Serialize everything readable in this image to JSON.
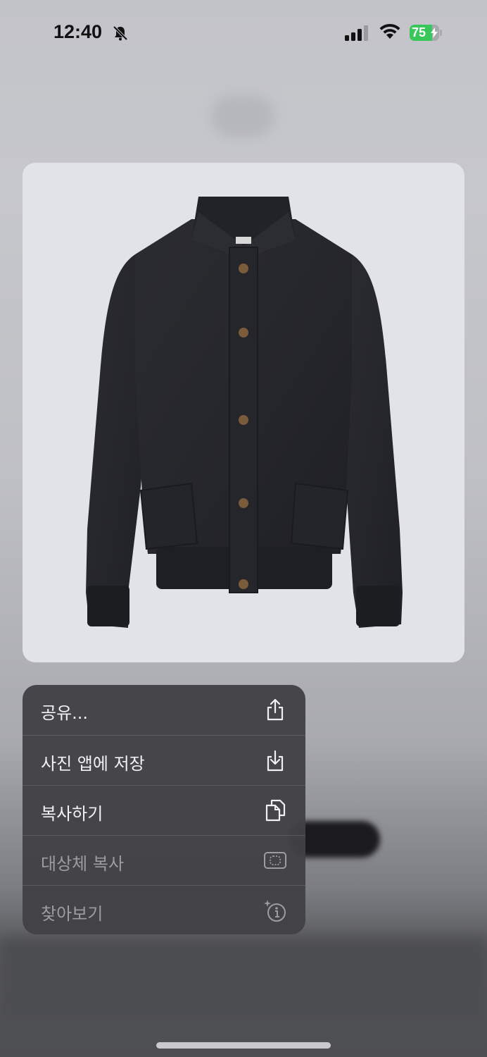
{
  "status_bar": {
    "time": "12:40",
    "battery_percent": "75",
    "battery_level": 0.75,
    "battery_color": "#39c75c",
    "icons": [
      "bell-slash-icon",
      "cellular-signal-icon",
      "wifi-icon",
      "battery-charging-icon"
    ]
  },
  "preview": {
    "image_label": "black-button-up-jacket-image",
    "card_color": "#e2e3e8"
  },
  "context_menu": {
    "items": [
      {
        "label": "공유...",
        "icon": "share-icon",
        "enabled": true
      },
      {
        "label": "사진 앱에 저장",
        "icon": "save-to-photos-icon",
        "enabled": true
      },
      {
        "label": "복사하기",
        "icon": "copy-icon",
        "enabled": true
      },
      {
        "label": "대상체 복사",
        "icon": "copy-subject-icon",
        "enabled": false
      },
      {
        "label": "찾아보기",
        "icon": "visual-look-up-icon",
        "enabled": false
      }
    ]
  }
}
